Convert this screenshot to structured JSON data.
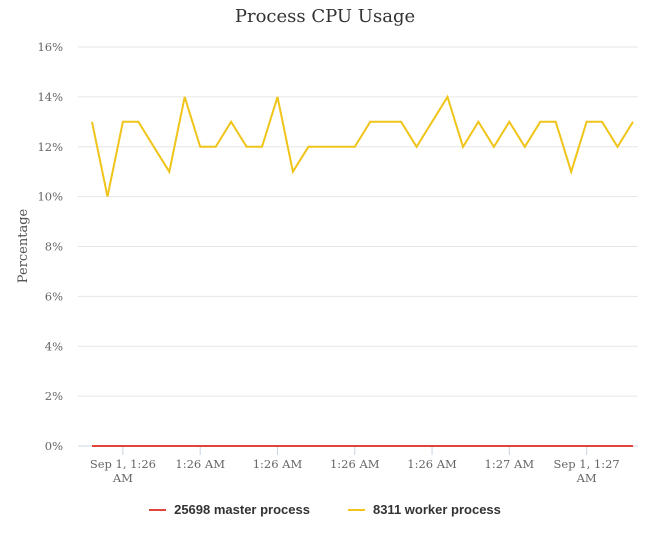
{
  "chart_data": {
    "type": "line",
    "title": "Process CPU Usage",
    "xlabel": "",
    "ylabel": "Percentage",
    "ylim": [
      0,
      16
    ],
    "y_ticks": [
      0,
      2,
      4,
      6,
      8,
      10,
      12,
      14,
      16
    ],
    "y_tick_suffix": "%",
    "grid": true,
    "legend_position": "bottom",
    "x_tick_labels": [
      {
        "index": 2,
        "lines": [
          "Sep 1, 1:26",
          "AM"
        ]
      },
      {
        "index": 7,
        "lines": [
          "1:26 AM"
        ]
      },
      {
        "index": 12,
        "lines": [
          "1:26 AM"
        ]
      },
      {
        "index": 17,
        "lines": [
          "1:26 AM"
        ]
      },
      {
        "index": 22,
        "lines": [
          "1:26 AM"
        ]
      },
      {
        "index": 27,
        "lines": [
          "1:27 AM"
        ]
      },
      {
        "index": 32,
        "lines": [
          "Sep 1, 1:27",
          "AM"
        ]
      }
    ],
    "point_count": 36,
    "series": [
      {
        "name": "25698 master process",
        "color": "#e0453a",
        "values": [
          0,
          0,
          0,
          0,
          0,
          0,
          0,
          0,
          0,
          0,
          0,
          0,
          0,
          0,
          0,
          0,
          0,
          0,
          0,
          0,
          0,
          0,
          0,
          0,
          0,
          0,
          0,
          0,
          0,
          0,
          0,
          0,
          0,
          0,
          0,
          0
        ]
      },
      {
        "name": "8311 worker process",
        "color": "#f0c419",
        "values": [
          13,
          10,
          13,
          13,
          12,
          11,
          14,
          12,
          12,
          13,
          12,
          12,
          14,
          11,
          12,
          12,
          12,
          12,
          13,
          13,
          13,
          12,
          13,
          14,
          12,
          13,
          12,
          13,
          12,
          13,
          13,
          11,
          13,
          13,
          12,
          13
        ]
      }
    ]
  }
}
